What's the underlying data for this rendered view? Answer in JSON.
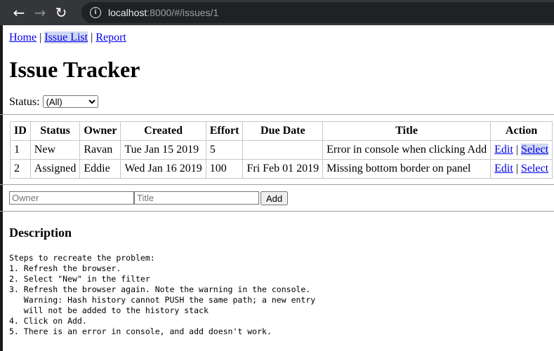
{
  "browser": {
    "back_icon": "arrow-left",
    "forward_icon": "arrow-right",
    "reload_icon": "reload",
    "url_host": "localhost",
    "url_rest": ":8000/#/issues/1"
  },
  "nav": {
    "home": "Home",
    "issue_list": "Issue List",
    "report": "Report",
    "sep": "|"
  },
  "title": "Issue Tracker",
  "filter": {
    "label": "Status:",
    "selected": "(All)"
  },
  "table": {
    "headers": [
      "ID",
      "Status",
      "Owner",
      "Created",
      "Effort",
      "Due Date",
      "Title",
      "Action"
    ],
    "rows": [
      {
        "id": "1",
        "status": "New",
        "owner": "Ravan",
        "created": "Tue Jan 15 2019",
        "effort": "5",
        "due": "",
        "title": "Error in console when clicking Add",
        "edit": "Edit",
        "select": "Select"
      },
      {
        "id": "2",
        "status": "Assigned",
        "owner": "Eddie",
        "created": "Wed Jan 16 2019",
        "effort": "100",
        "due": "Fri Feb 01 2019",
        "title": "Missing bottom border on panel",
        "edit": "Edit",
        "select": "Select"
      }
    ]
  },
  "add_form": {
    "owner_placeholder": "Owner",
    "title_placeholder": "Title",
    "add_label": "Add"
  },
  "description": {
    "heading": "Description",
    "text": "Steps to recreate the problem:\n1. Refresh the browser.\n2. Select \"New\" in the filter\n3. Refresh the browser again. Note the warning in the console.\n   Warning: Hash history cannot PUSH the same path; a new entry\n   will not be added to the history stack\n4. Click on Add.\n5. There is an error in console, and add doesn't work."
  }
}
